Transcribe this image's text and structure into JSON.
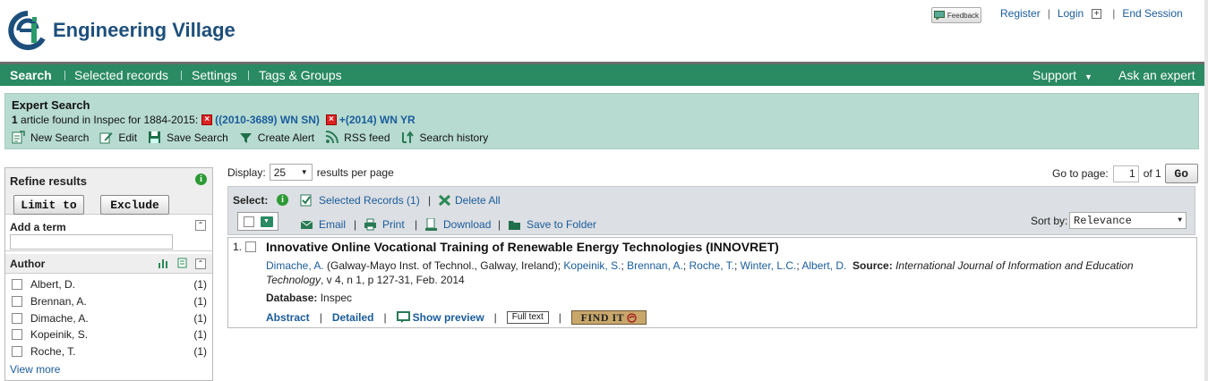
{
  "app": {
    "name": "Engineering Village"
  },
  "top": {
    "feedback_label": "Feedback",
    "register": "Register",
    "login": "Login",
    "end_session": "End Session"
  },
  "nav": {
    "left": [
      "Search",
      "Selected records",
      "Settings",
      "Tags & Groups"
    ],
    "support": "Support",
    "ask": "Ask an expert"
  },
  "search_panel": {
    "title": "Expert Search",
    "count": "1",
    "desc": "article found in Inspec for 1884-2015:",
    "term1": "((2010-3689) WN SN)",
    "term2": "+(2014) WN YR",
    "actions": [
      "New Search",
      "Edit",
      "Save Search",
      "Create Alert",
      "RSS feed",
      "Search history"
    ]
  },
  "refine": {
    "title": "Refine results",
    "limit_to": "Limit to",
    "exclude": "Exclude",
    "add_term": "Add a term",
    "author_title": "Author",
    "authors": [
      {
        "name": "Albert, D.",
        "count": "(1)"
      },
      {
        "name": "Brennan, A.",
        "count": "(1)"
      },
      {
        "name": "Dimache, A.",
        "count": "(1)"
      },
      {
        "name": "Kopeinik, S.",
        "count": "(1)"
      },
      {
        "name": "Roche, T.",
        "count": "(1)"
      }
    ],
    "view_more": "View more"
  },
  "display": {
    "label": "Display:",
    "value": "25",
    "suffix": "results per page"
  },
  "goto": {
    "label": "Go to page:",
    "page": "1",
    "of": "of 1",
    "go": "Go"
  },
  "toolbar": {
    "select_label": "Select:",
    "selected_records": "Selected Records (1)",
    "delete_all": "Delete All",
    "email": "Email",
    "print": "Print",
    "download": "Download",
    "save_folder": "Save to Folder",
    "sort_label": "Sort by:",
    "sort_value": "Relevance"
  },
  "result": {
    "number": "1.",
    "title": "Innovative Online Vocational Training of Renewable Energy Technologies (INNOVRET)",
    "author1": "Dimache, A.",
    "affiliation": "(Galway-Mayo Inst. of Technol., Galway, Ireland);",
    "author2": "Kopeinik, S.",
    "author3": "Brennan, A.",
    "author4": "Roche, T.",
    "author5": "Winter, L.C.",
    "author6": "Albert, D.",
    "source_label": "Source:",
    "source": "International Journal of Information and Education Technology",
    "source_detail": ", v 4, n 1, p 127-31, Feb. 2014",
    "db_label": "Database:",
    "db": "Inspec",
    "abstract": "Abstract",
    "detailed": "Detailed",
    "show_preview": "Show preview",
    "full_text": "Full text",
    "find_it": "FIND IT"
  },
  "colors": {
    "nav_green": "#2a8a62",
    "panel_green": "#b7dbd0",
    "link_blue": "#1a5c9c",
    "brand_blue": "#1d4f7c"
  }
}
